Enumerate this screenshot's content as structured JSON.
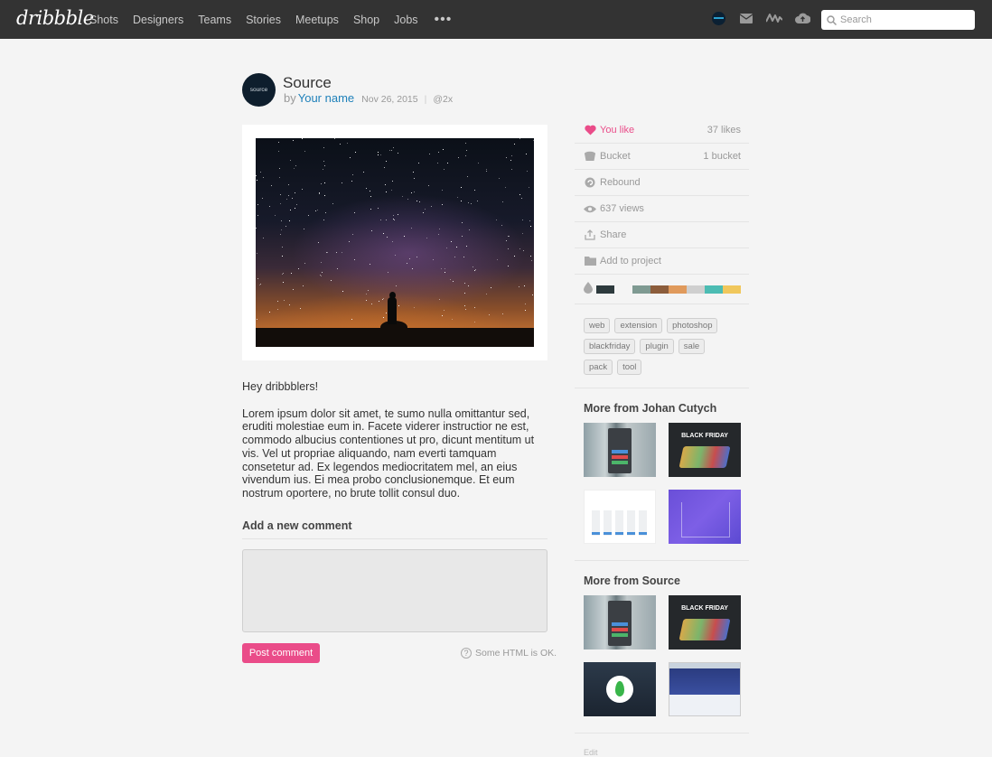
{
  "header": {
    "logo": "dribbble",
    "nav": [
      "Shots",
      "Designers",
      "Teams",
      "Stories",
      "Meetups",
      "Shop",
      "Jobs"
    ],
    "more": "•••",
    "icons": [
      "profile-avatar",
      "mail-icon",
      "activity-icon",
      "upload-icon"
    ],
    "search_placeholder": "Search"
  },
  "shot": {
    "avatar_text": "source",
    "title": "Source",
    "by_label": "by",
    "author": "Your name",
    "date": "Nov 26, 2015",
    "separator": "|",
    "resolution": "@2x",
    "greeting": "Hey dribbblers!",
    "description": "Lorem ipsum dolor sit amet, te sumo nulla omittantur sed, eruditi molestiae eum in. Facete viderer instructior ne est, commodo albucius contentiones ut pro, dicunt mentitum ut vis. Vel ut propriae aliquando, nam everti tamquam consetetur ad. Ex legendos mediocritatem mel, an eius vivendum ius. Ei mea probo conclusionemque. Et eum nostrum oportere, no brute tollit consul duo."
  },
  "comment": {
    "title": "Add a new comment",
    "placeholder": "",
    "button": "Post comment",
    "help_icon": "?",
    "help": "Some HTML is OK."
  },
  "sidebar": {
    "likes_label": "You like",
    "likes_count": "37 likes",
    "bucket_label": "Bucket",
    "bucket_count": "1 bucket",
    "rebound_label": "Rebound",
    "views_label": "637 views",
    "share_label": "Share",
    "project_label": "Add to project",
    "palette": [
      "#2d3a3d",
      "#f4f4f4",
      "#7f9a92",
      "#8c5d3c",
      "#e09a5c",
      "#cfcfcf",
      "#4cbcb3",
      "#f0c75c"
    ],
    "tags": [
      "web",
      "extension",
      "photoshop",
      "blackfriday",
      "plugin",
      "sale",
      "pack",
      "tool"
    ],
    "more_from_author": "More from Johan Cutych",
    "more_from_source": "More from Source",
    "thumb_text": "BLACK FRIDAY",
    "edit": "Edit"
  },
  "colors": {
    "accent": "#ea4c89",
    "link": "#1f81ba",
    "header_bg": "#333333"
  }
}
